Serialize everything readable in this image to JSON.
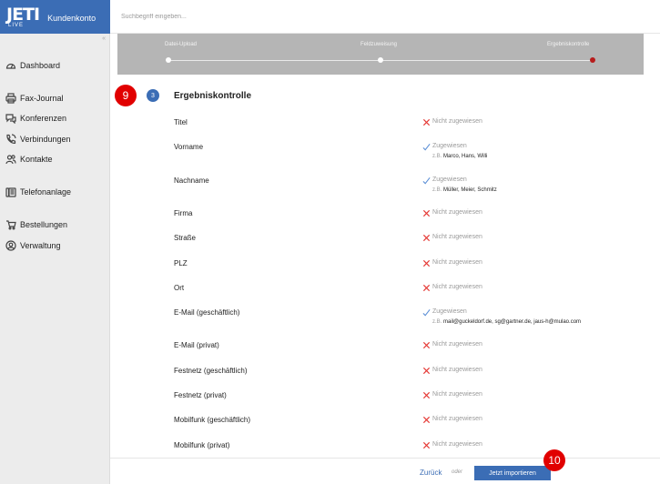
{
  "header": {
    "logo_text": "JETI",
    "logo_sub_text": "LIVE",
    "account_label": "Kundenkonto",
    "search_placeholder": "Suchbegriff eingeben..."
  },
  "sidebar": {
    "collapse_glyph": "«",
    "items": [
      {
        "label": "Dashboard",
        "icon": "dashboard-icon"
      },
      {
        "label": "Fax-Journal",
        "icon": "printer-icon"
      },
      {
        "label": "Konferenzen",
        "icon": "chat-icon"
      },
      {
        "label": "Verbindungen",
        "icon": "phone-icon"
      },
      {
        "label": "Kontakte",
        "icon": "users-icon"
      },
      {
        "label": "Telefonanlage",
        "icon": "phone-system-icon"
      },
      {
        "label": "Bestellungen",
        "icon": "cart-icon"
      },
      {
        "label": "Verwaltung",
        "icon": "user-settings-icon"
      }
    ]
  },
  "stepper": {
    "steps": [
      "Datei-Upload",
      "Feldzuweisung",
      "Ergebniskontrolle"
    ],
    "active_index": 2,
    "active_color": "#b71c1c"
  },
  "markers": {
    "first": "9",
    "second": "10"
  },
  "section": {
    "number": "3",
    "title": "Ergebniskontrolle"
  },
  "fields": [
    {
      "name": "Titel",
      "assigned": false,
      "status": "Nicht zugewiesen"
    },
    {
      "name": "Vorname",
      "assigned": true,
      "status": "Zugewiesen",
      "example_prefix": "z.B.",
      "example": "Marco, Hans, Willi"
    },
    {
      "name": "Nachname",
      "assigned": true,
      "status": "Zugewiesen",
      "example_prefix": "z.B.",
      "example": "Müller, Meier, Schmitz"
    },
    {
      "name": "Firma",
      "assigned": false,
      "status": "Nicht zugewiesen"
    },
    {
      "name": "Straße",
      "assigned": false,
      "status": "Nicht zugewiesen"
    },
    {
      "name": "PLZ",
      "assigned": false,
      "status": "Nicht zugewiesen"
    },
    {
      "name": "Ort",
      "assigned": false,
      "status": "Nicht zugewiesen"
    },
    {
      "name": "E-Mail (geschäftlich)",
      "assigned": true,
      "status": "Zugewiesen",
      "example_prefix": "z.B.",
      "example": "mail@guckeldorf.de, sg@gartner.de, jaus-h@mulao.com"
    },
    {
      "name": "E-Mail (privat)",
      "assigned": false,
      "status": "Nicht zugewiesen"
    },
    {
      "name": "Festnetz (geschäftlich)",
      "assigned": false,
      "status": "Nicht zugewiesen"
    },
    {
      "name": "Festnetz (privat)",
      "assigned": false,
      "status": "Nicht zugewiesen"
    },
    {
      "name": "Mobilfunk (geschäftlich)",
      "assigned": false,
      "status": "Nicht zugewiesen"
    },
    {
      "name": "Mobilfunk (privat)",
      "assigned": false,
      "status": "Nicht zugewiesen"
    }
  ],
  "footer": {
    "back_label": "Zurück",
    "or_label": "oder",
    "import_label": "Jetzt importieren"
  },
  "colors": {
    "brand_blue": "#3b6db5",
    "marker_red": "#e10000",
    "cross_red": "#e53935",
    "check_blue": "#5b8fd6"
  }
}
